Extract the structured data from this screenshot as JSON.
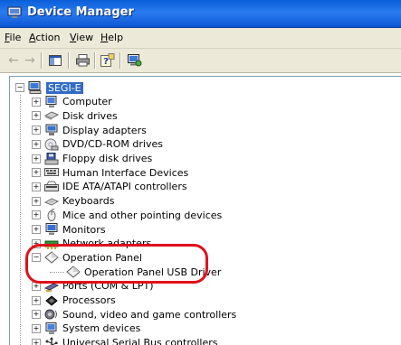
{
  "window": {
    "title": "Device Manager"
  },
  "menu": [
    {
      "label": "File",
      "u": "F",
      "rest": "ile"
    },
    {
      "label": "Action",
      "u": "A",
      "rest": "ction"
    },
    {
      "label": "View",
      "u": "V",
      "rest": "iew"
    },
    {
      "label": "Help",
      "u": "H",
      "rest": "elp"
    }
  ],
  "tree": {
    "root": "SEGI-E",
    "items": [
      {
        "label": "Computer",
        "icon": "computer-icon",
        "expander": "+"
      },
      {
        "label": "Disk drives",
        "icon": "disk-drive-icon",
        "expander": "+"
      },
      {
        "label": "Display adapters",
        "icon": "display-adapter-icon",
        "expander": "+"
      },
      {
        "label": "DVD/CD-ROM drives",
        "icon": "cdrom-icon",
        "expander": "+"
      },
      {
        "label": "Floppy disk drives",
        "icon": "floppy-icon",
        "expander": "+"
      },
      {
        "label": "Human Interface Devices",
        "icon": "hid-icon",
        "expander": "+"
      },
      {
        "label": "IDE ATA/ATAPI controllers",
        "icon": "ide-controller-icon",
        "expander": "+"
      },
      {
        "label": "Keyboards",
        "icon": "keyboard-icon",
        "expander": "+"
      },
      {
        "label": "Mice and other pointing devices",
        "icon": "mouse-icon",
        "expander": "+"
      },
      {
        "label": "Monitors",
        "icon": "monitor-icon",
        "expander": "+"
      },
      {
        "label": "Network adapters",
        "icon": "network-adapter-icon",
        "expander": "+"
      },
      {
        "label": "Operation Panel",
        "icon": "diamond-device-icon",
        "expander": "−"
      },
      {
        "label": "Operation Panel USB Driver",
        "icon": "diamond-device-icon",
        "expander": "",
        "child": true
      },
      {
        "label": "Ports (COM & LPT)",
        "icon": "port-icon",
        "expander": "+"
      },
      {
        "label": "Processors",
        "icon": "processor-icon",
        "expander": "+"
      },
      {
        "label": "Sound, video and game controllers",
        "icon": "sound-icon",
        "expander": "+"
      },
      {
        "label": "System devices",
        "icon": "system-device-icon",
        "expander": "+"
      },
      {
        "label": "Universal Serial Bus controllers",
        "icon": "usb-icon",
        "expander": "+"
      }
    ]
  },
  "colors": {
    "title_bar": "#0a5fd8",
    "selection": "#316ac5",
    "highlight_ring": "#e0101a",
    "chrome": "#ece9d8"
  }
}
